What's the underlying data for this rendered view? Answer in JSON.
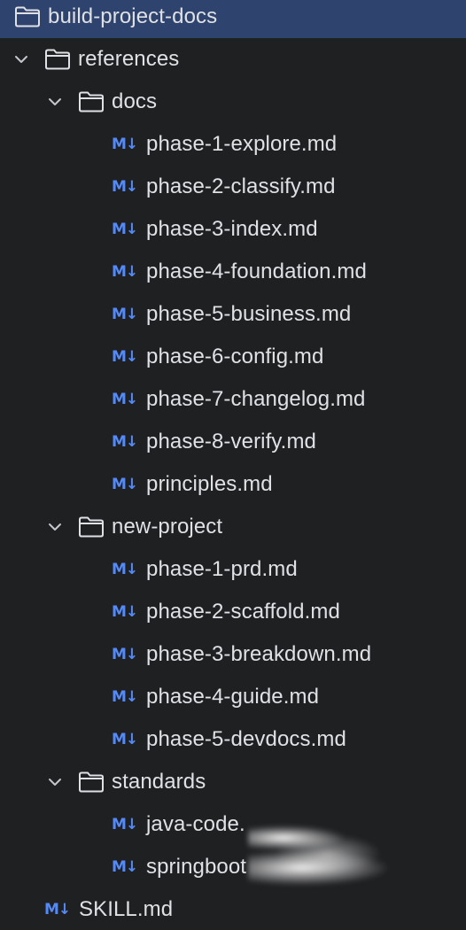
{
  "colors": {
    "background": "#1f2022",
    "selection": "#2e436e",
    "text": "#dfe1e5",
    "markdown_icon": "#548af7"
  },
  "icons": {
    "folder": "folder-icon",
    "chevron": "chevron-down-icon",
    "markdown": "markdown-file-icon"
  },
  "markdown_icon_text": "M↓",
  "tree": {
    "root": {
      "label": "build-project-docs",
      "selected": true
    },
    "references": {
      "label": "references",
      "expanded": true,
      "docs": {
        "label": "docs",
        "expanded": true,
        "files": [
          "phase-1-explore.md",
          "phase-2-classify.md",
          "phase-3-index.md",
          "phase-4-foundation.md",
          "phase-5-business.md",
          "phase-6-config.md",
          "phase-7-changelog.md",
          "phase-8-verify.md",
          "principles.md"
        ]
      },
      "new_project": {
        "label": "new-project",
        "expanded": true,
        "files": [
          "phase-1-prd.md",
          "phase-2-scaffold.md",
          "phase-3-breakdown.md",
          "phase-4-guide.md",
          "phase-5-devdocs.md"
        ]
      },
      "standards": {
        "label": "standards",
        "expanded": true,
        "files": [
          "java-code.",
          "springboot"
        ]
      }
    },
    "skill_file": "SKILL.md"
  }
}
